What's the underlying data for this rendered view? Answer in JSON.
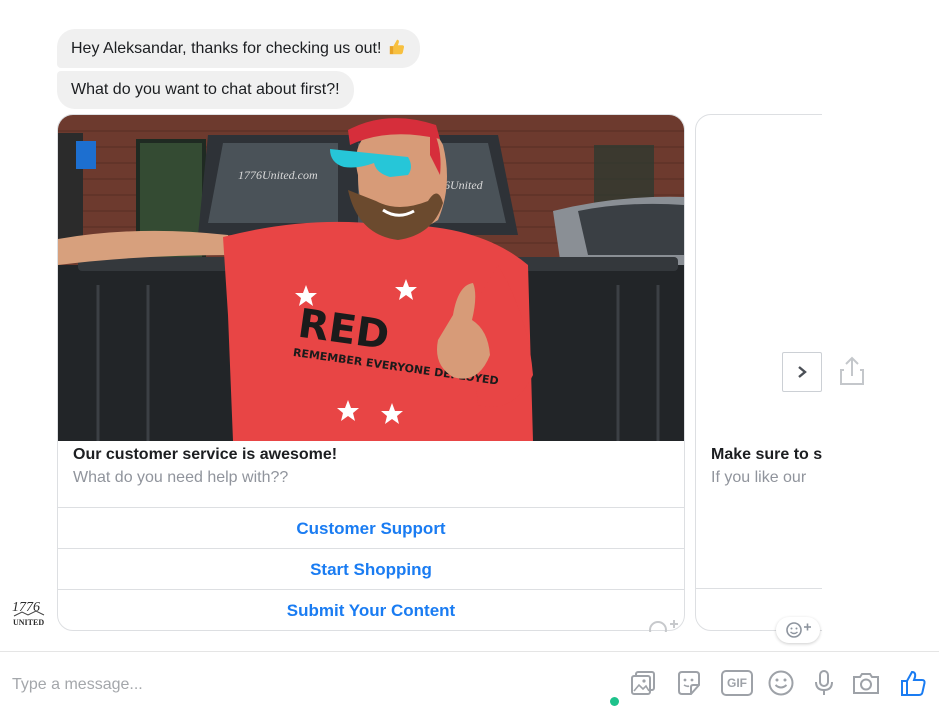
{
  "messages": [
    {
      "text": "Hey Aleksandar, thanks for checking us out!",
      "emoji": "thumbs-up-emoji"
    },
    {
      "text": "What do you want to chat about first?!"
    }
  ],
  "carousel": {
    "cards": [
      {
        "title": "Our customer service is awesome!",
        "subtitle": "What do you need help with??",
        "image_overlay": {
          "shirt_text": "RED",
          "shirt_subtext": "REMEMBER EVERYONE DEPLOYED",
          "truck_text_1": "1776United.com",
          "truck_text_2": "1776United"
        },
        "buttons": [
          "Customer Support",
          "Start Shopping",
          "Submit Your Content"
        ]
      },
      {
        "title": "Make sure to s",
        "subtitle": "If you like our"
      }
    ]
  },
  "avatar": {
    "line1": "1776",
    "line2": "UNITED"
  },
  "composer": {
    "placeholder": "Type a message...",
    "tools": [
      "photo-icon",
      "sticker-icon",
      "gif-icon",
      "emoji-icon",
      "microphone-icon",
      "camera-icon",
      "like-icon"
    ],
    "gif_label": "GIF"
  },
  "colors": {
    "accent": "#1a7cf2",
    "bubble": "#f0f0f0",
    "border": "#dddfe2",
    "online": "#1ec28b",
    "toolbar_icon": "#9ea2a8"
  }
}
